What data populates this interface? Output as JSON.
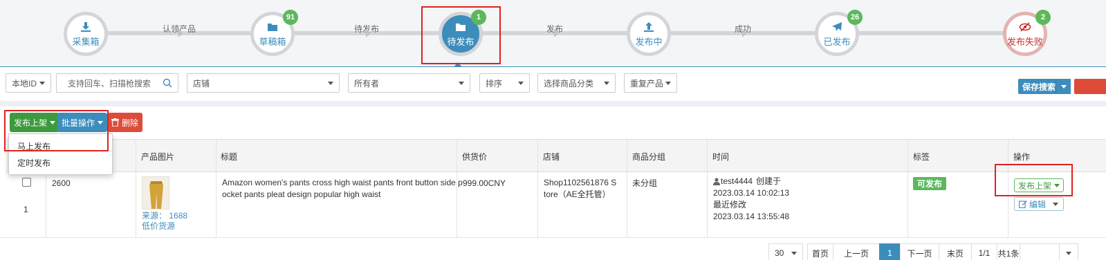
{
  "workflow": {
    "steps": [
      {
        "label": "采集箱",
        "icon": "download-icon",
        "badge": ""
      },
      {
        "label": "草稿箱",
        "icon": "folder-icon",
        "badge": "91"
      },
      {
        "label": "待发布",
        "icon": "folder-icon",
        "badge": "1"
      },
      {
        "label": "发布中",
        "icon": "upload-icon",
        "badge": ""
      },
      {
        "label": "已发布",
        "icon": "send-icon",
        "badge": "26"
      },
      {
        "label": "发布失败",
        "icon": "eye-slash-icon",
        "badge": "2"
      }
    ],
    "transitions": [
      "认领产品",
      "待发布",
      "发布",
      "成功"
    ],
    "active_step": "待发布"
  },
  "filters": {
    "local_id": "本地ID",
    "search_placeholder": "支持回车、扫描枪搜索",
    "shop": "店铺",
    "owner": "所有者",
    "sort": "排序",
    "category": "选择商品分类",
    "duplicate": "重复产品",
    "save_search": "保存搜索"
  },
  "actions": {
    "publish": "发布上架",
    "batch": "批量操作",
    "delete": "删除"
  },
  "publish_menu": [
    "马上发布",
    "定时发布"
  ],
  "table": {
    "headers": [
      "产品图片",
      "标题",
      "供货价",
      "店铺",
      "商品分组",
      "时间",
      "标签",
      "操作"
    ],
    "rows": [
      {
        "index": "1",
        "id": "2600",
        "source_label": "来源：",
        "source_value": "1688",
        "source_note": "低价货源",
        "title_line1": "Amazon women's pants cross high waist pants front button side p",
        "title_line2": "ocket pants pleat design popular high waist",
        "price": "999.00CNY",
        "shop_line1": "Shop1102561876 S",
        "shop_line2": "tore（AE全托管）",
        "group": "未分组",
        "creator": "test4444",
        "created_label": "创建于",
        "created_time": "2023.03.14 10:02:13",
        "modified_label": "最近修改",
        "modified_time": "2023.03.14 13:55:48",
        "tag": "可发布",
        "op_publish": "发布上架",
        "op_edit": "编辑"
      }
    ]
  },
  "pagination": {
    "page_size": "30",
    "first": "首页",
    "prev": "上一页",
    "current": "1",
    "next": "下一页",
    "last": "末页",
    "page_of": "1/1",
    "total": "共1条"
  },
  "colors": {
    "primary": "#3c8dbc",
    "success": "#5cb85c",
    "danger": "#dd4b39",
    "highlight_border": "#e02020"
  }
}
